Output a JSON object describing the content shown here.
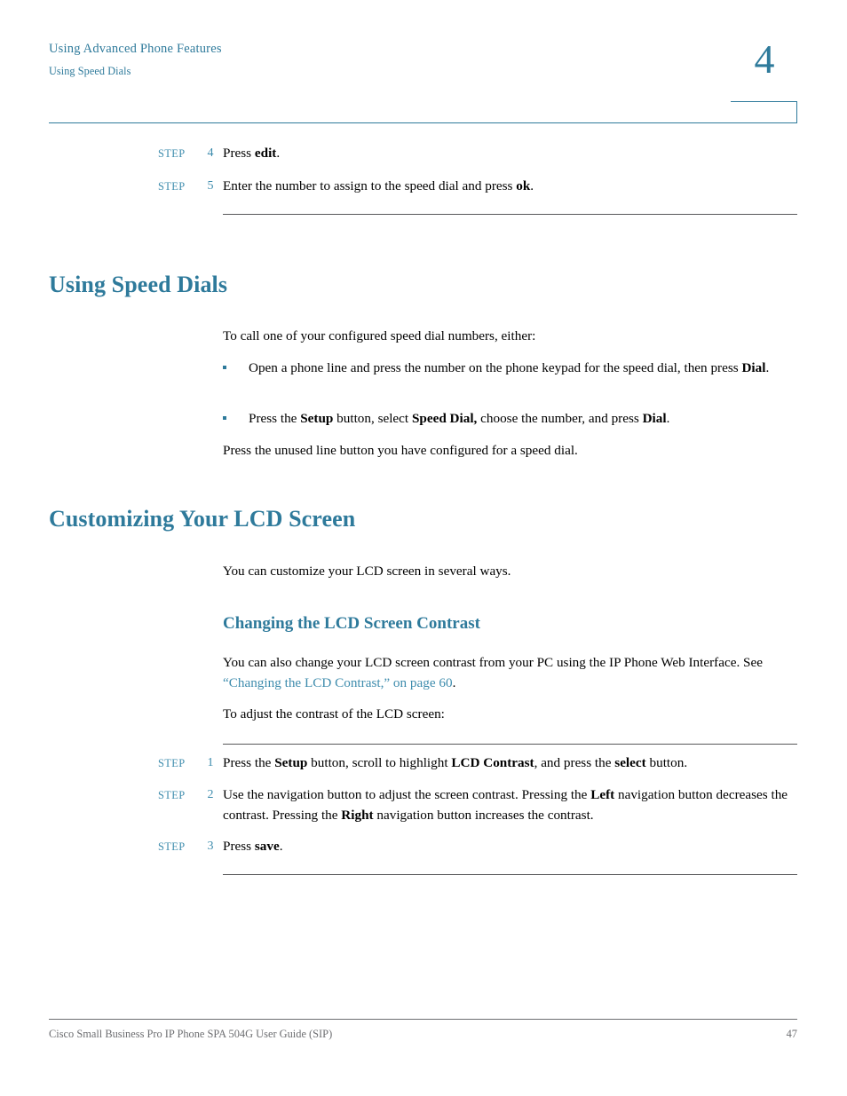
{
  "header": {
    "title": "Using Advanced Phone Features",
    "subtitle": "Using Speed Dials",
    "chapter_number": "4"
  },
  "colors": {
    "heading_teal": "#2E7A9B",
    "link_teal": "#3E8CAD",
    "rule_gray": "#58585a",
    "footer_gray": "#6d6e71",
    "body_black": "#000000"
  },
  "steps_top": [
    {
      "label": "STEP",
      "number": "4",
      "text_before": "Press ",
      "bold": "edit",
      "text_after": "."
    },
    {
      "label": "STEP",
      "number": "5",
      "text_before": "Enter the number to assign to the speed dial and press ",
      "bold": "ok",
      "text_after": "."
    }
  ],
  "section_speed_dials": {
    "heading": "Using Speed Dials",
    "intro": "To call one of your configured speed dial numbers, either:",
    "bullets": [
      {
        "text_before": "Open a phone line and press the number on the phone keypad for the speed dial, then press ",
        "bold": "Dial",
        "text_after": "."
      },
      {
        "part1": "Press the ",
        "bold1": "Setup",
        "part2": " button, select ",
        "bold2": "Speed Dial,",
        "part3": " choose the number, and press ",
        "bold3": "Dial",
        "part4": "."
      }
    ],
    "closing": "Press the unused line button you have configured for a speed dial."
  },
  "section_lcd": {
    "heading": "Customizing Your LCD Screen",
    "intro": "You can customize your LCD screen in several ways.",
    "subheading": "Changing the LCD Screen Contrast",
    "paragraph_before_link": "You can also change your LCD screen contrast from your PC using the IP Phone Web Interface. See ",
    "link_text": "“Changing the LCD Contrast,” on page 60",
    "paragraph_after_link": ".",
    "lead_in": "To adjust the contrast of the LCD screen:"
  },
  "steps_bottom": [
    {
      "label": "STEP",
      "number": "1",
      "part1": "Press the ",
      "bold1": "Setup",
      "part2": " button, scroll to highlight ",
      "bold2": "LCD Contrast",
      "part3": ", and press the ",
      "bold3": "select",
      "part4": " button."
    },
    {
      "label": "STEP",
      "number": "2",
      "part1": "Use the navigation button to adjust the screen contrast. Pressing the ",
      "bold1": "Left",
      "part2": " navigation button decreases the contrast. Pressing the ",
      "bold2": "Right",
      "part3": " navigation button increases the contrast.",
      "bold3": "",
      "part4": ""
    },
    {
      "label": "STEP",
      "number": "3",
      "part1": "Press ",
      "bold1": "save",
      "part2": ".",
      "bold2": "",
      "part3": "",
      "bold3": "",
      "part4": ""
    }
  ],
  "footer": {
    "left": "Cisco Small Business Pro IP Phone SPA 504G User Guide (SIP)",
    "page_number": "47"
  }
}
